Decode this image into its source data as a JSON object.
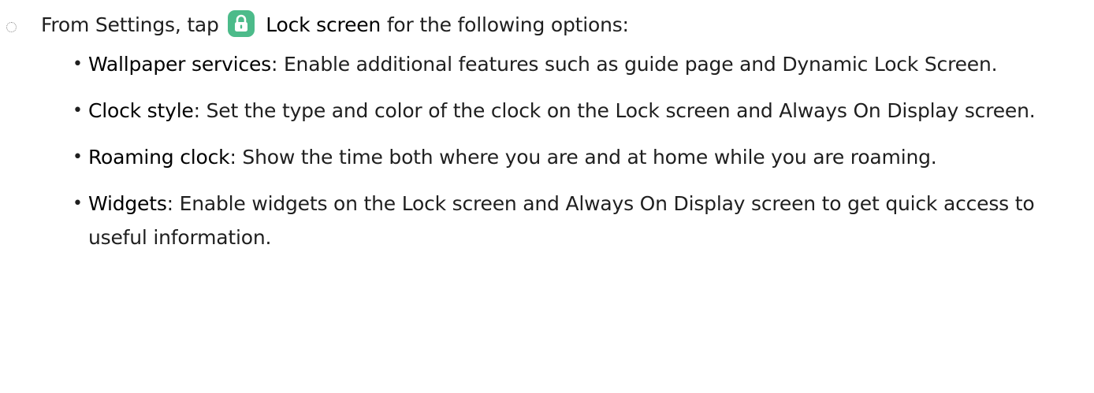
{
  "intro": {
    "prefix": "From Settings, tap",
    "icon": "lock-icon",
    "link_label": "Lock screen",
    "suffix": "for the following options:"
  },
  "options": [
    {
      "term": "Wallpaper services",
      "desc": ": Enable additional features such as guide page and Dynamic Lock Screen."
    },
    {
      "term": "Clock style",
      "desc": ": Set the type and color of the clock on the Lock screen and Always On Display screen."
    },
    {
      "term": "Roaming clock",
      "desc": ": Show the time both where you are and at home while you are roaming."
    },
    {
      "term": "Widgets",
      "desc": ": Enable widgets on the Lock screen and Always On Display screen to get quick access to useful information."
    }
  ],
  "colors": {
    "icon_bg": "#4cbb8a",
    "text": "#1f1f1f"
  }
}
